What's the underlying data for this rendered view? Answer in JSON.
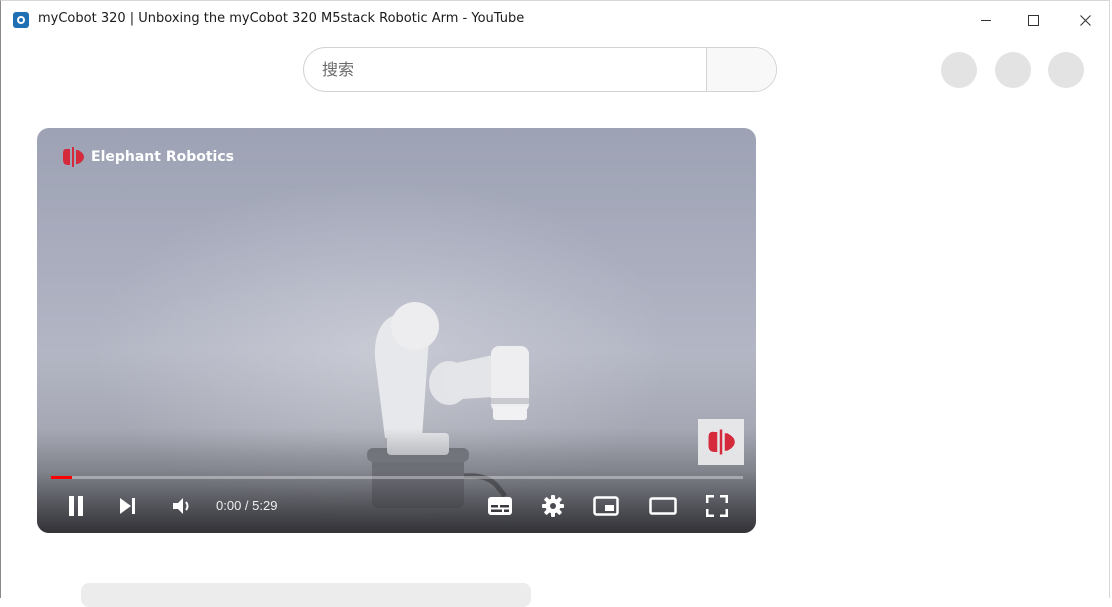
{
  "window": {
    "title": "myCobot 320 | Unboxing the myCobot 320 M5stack Robotic Arm - YouTube",
    "icon": "app-icon"
  },
  "search": {
    "placeholder": "搜索",
    "value": ""
  },
  "player": {
    "channel_logo_text": "Elephant Robotics",
    "time_display": "0:00 / 5:29",
    "progress_fraction": 0.03,
    "accent_color": "#ff0000",
    "brand_color": "#d42a3c",
    "controls": {
      "pause": "pause-icon",
      "next": "next-icon",
      "volume": "volume-icon",
      "subtitles": "subtitles-icon",
      "settings": "settings-icon",
      "miniplayer": "miniplayer-icon",
      "theater": "theater-icon",
      "fullscreen": "fullscreen-icon"
    }
  }
}
